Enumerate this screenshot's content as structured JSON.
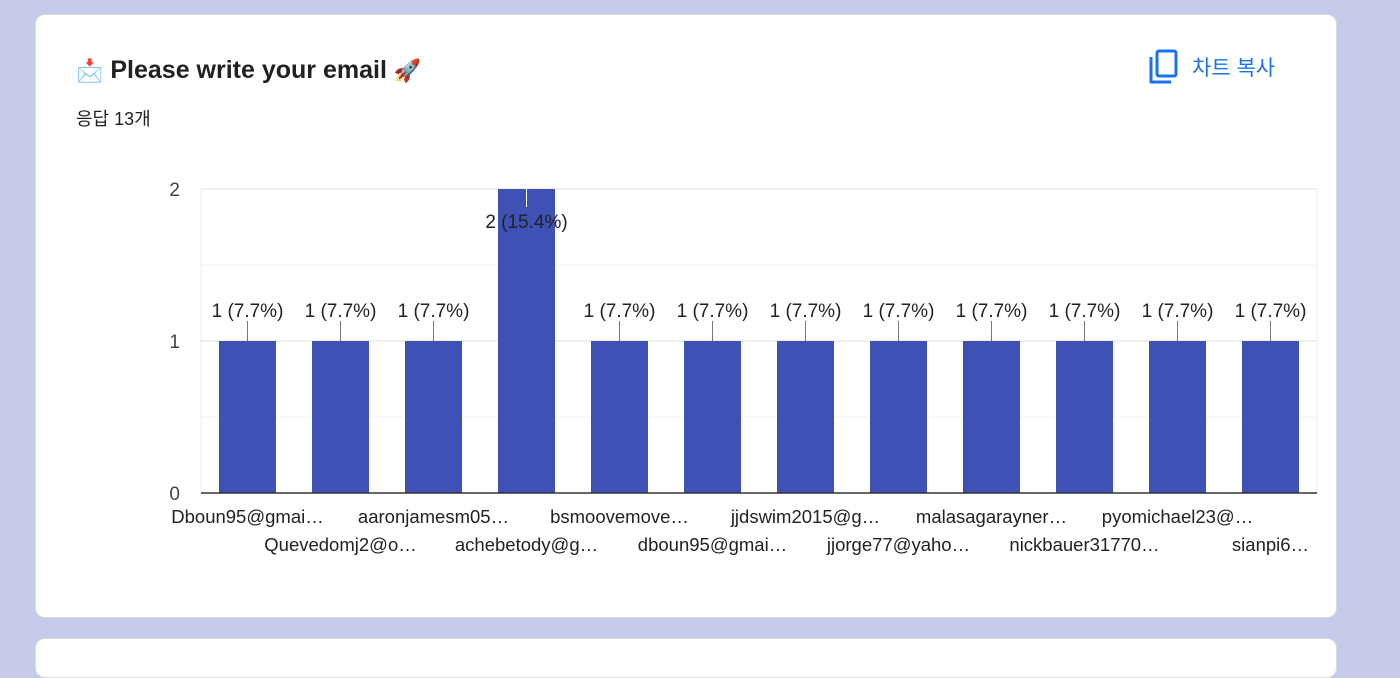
{
  "question": {
    "icon": "envelope-icon",
    "rocket_icon": "rocket-icon",
    "text": "Please write your email",
    "icon_glyph": "📩",
    "rocket_glyph": "🚀",
    "response_count": "응답 13개"
  },
  "copy_button": {
    "label": "차트 복사",
    "icon": "copy-icon"
  },
  "colors": {
    "bar": "#3f51b5",
    "accent": "#1a73e8",
    "background": "#c5cae9"
  },
  "chart_data": {
    "type": "bar",
    "categories": [
      "Dboun95@gmai…",
      "Quevedomj2@o…",
      "aaronjamesm05…",
      "achebetody@g…",
      "bsmoovemove…",
      "dboun95@gmai…",
      "jjdswim2015@g…",
      "jjorge77@yaho…",
      "malasagarayner…",
      "nickbauer31770…",
      "pyomichael23@…",
      "sianpi6…"
    ],
    "values": [
      1,
      1,
      1,
      2,
      1,
      1,
      1,
      1,
      1,
      1,
      1,
      1
    ],
    "data_labels": [
      "1 (7.7%)",
      "1 (7.7%)",
      "1 (7.7%)",
      "2 (15.4%)",
      "1 (7.7%)",
      "1 (7.7%)",
      "1 (7.7%)",
      "1 (7.7%)",
      "1 (7.7%)",
      "1 (7.7%)",
      "1 (7.7%)",
      "1 (7.7%)"
    ],
    "yticks": [
      "0",
      "1",
      "2"
    ],
    "ylim": [
      0,
      2
    ],
    "grid": true,
    "title": "",
    "xlabel": "",
    "ylabel": ""
  }
}
